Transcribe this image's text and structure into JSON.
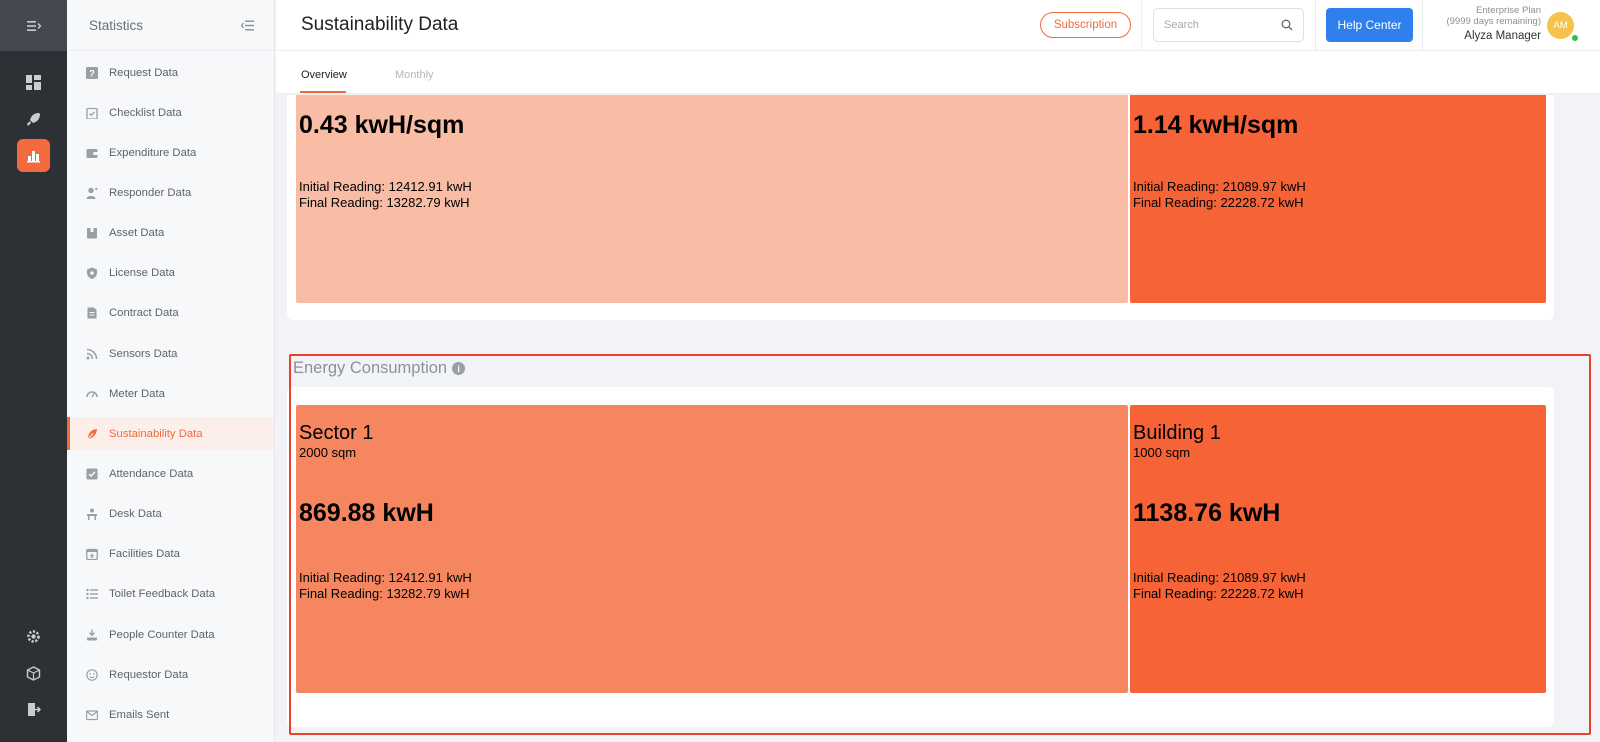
{
  "sidebar": {
    "title": "Statistics",
    "items": [
      {
        "label": "Request Data",
        "icon": "question-box-icon"
      },
      {
        "label": "Checklist Data",
        "icon": "clipboard-check-icon"
      },
      {
        "label": "Expenditure Data",
        "icon": "wallet-icon"
      },
      {
        "label": "Responder Data",
        "icon": "person-icon"
      },
      {
        "label": "Asset Data",
        "icon": "cube-box-icon"
      },
      {
        "label": "License Data",
        "icon": "shield-icon"
      },
      {
        "label": "Contract Data",
        "icon": "document-icon"
      },
      {
        "label": "Sensors Data",
        "icon": "rss-icon"
      },
      {
        "label": "Meter Data",
        "icon": "gauge-icon"
      },
      {
        "label": "Sustainability Data",
        "icon": "leaf-icon"
      },
      {
        "label": "Attendance Data",
        "icon": "check-square-icon"
      },
      {
        "label": "Desk Data",
        "icon": "desk-icon"
      },
      {
        "label": "Facilities Data",
        "icon": "calendar-plus-icon"
      },
      {
        "label": "Toilet Feedback Data",
        "icon": "list-icon"
      },
      {
        "label": "People Counter Data",
        "icon": "people-download-icon"
      },
      {
        "label": "Requestor Data",
        "icon": "smile-icon"
      },
      {
        "label": "Emails Sent",
        "icon": "mail-icon"
      }
    ],
    "active_index": 9
  },
  "header": {
    "title": "Sustainability Data",
    "subscription_label": "Subscription",
    "search_placeholder": "Search",
    "help_label": "Help Center",
    "plan_name": "Enterprise Plan",
    "plan_remaining": "(9999 days remaining)",
    "user_name": "Alyza Manager",
    "avatar_initials": "AM"
  },
  "tabs": [
    {
      "label": "Overview",
      "active": true
    },
    {
      "label": "Monthly",
      "active": false
    }
  ],
  "intensity": {
    "tiles": [
      {
        "value": "0.43 kwH/sqm",
        "initial": "Initial Reading: 12412.91 kwH",
        "final": "Final Reading: 13282.79 kwH",
        "color": "#f9bda6"
      },
      {
        "value": "1.14 kwH/sqm",
        "initial": "Initial Reading: 21089.97 kwH",
        "final": "Final Reading: 22228.72 kwH",
        "color": "#f56337"
      }
    ]
  },
  "energy": {
    "title": "Energy Consumption",
    "tiles": [
      {
        "name": "Sector 1",
        "area": "2000 sqm",
        "value": "869.88 kwH",
        "initial": "Initial Reading: 12412.91 kwH",
        "final": "Final Reading: 13282.79 kwH",
        "color": "#f68660"
      },
      {
        "name": "Building 1",
        "area": "1000 sqm",
        "value": "1138.76 kwH",
        "initial": "Initial Reading: 21089.97 kwH",
        "final": "Final Reading: 22228.72 kwH",
        "color": "#f56337"
      }
    ]
  },
  "colors": {
    "accent": "#f26a3d",
    "primary": "#2f80ed",
    "highlight": "#e8412c"
  }
}
